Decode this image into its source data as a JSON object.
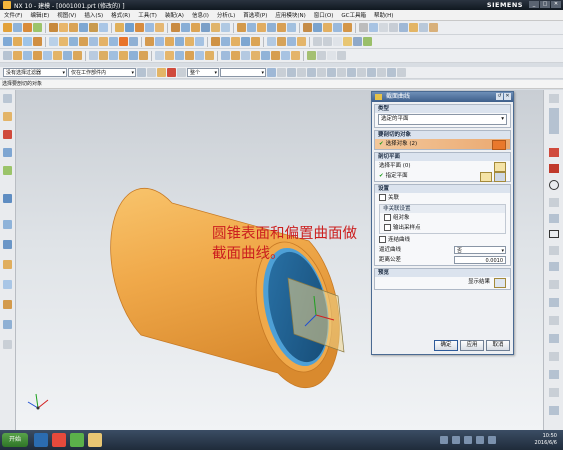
{
  "window": {
    "title": "NX 10 - 建模 - [0001001.prt (修改的) ]",
    "brand": "SIEMENS",
    "controls": [
      "_",
      "□",
      "✕"
    ]
  },
  "menu": [
    "文件(F)",
    "编辑(E)",
    "视图(V)",
    "插入(S)",
    "格式(R)",
    "工具(T)",
    "装配(A)",
    "信息(I)",
    "分析(L)",
    "首选项(P)",
    "应用模块(N)",
    "窗口(O)",
    "GC工具箱",
    "帮助(H)"
  ],
  "toolbar4": {
    "filter": "没有选择过滤器",
    "scope": "仅在工作部件内",
    "snap": "整个"
  },
  "breadcrumb": "选择要剖切的对象",
  "annotation": {
    "line1": "圆锥表面和偏置曲面做",
    "line2": "截面曲线。"
  },
  "dialog": {
    "title": "截面曲线",
    "type_header": "类型",
    "type_value": "选定的平面",
    "objects_header": "要剖切的对象",
    "objects_selected": "选择对象 (2)",
    "plane_header": "剖切平面",
    "plane_select": "选择平面 (0)",
    "plane_specify": "指定平面",
    "settings_header": "设置",
    "associative": "关联",
    "nonassoc_header": "非关联设置",
    "group_objects": "组对象",
    "output_points": "输出采样点",
    "join_curves": "连结曲线",
    "approx_label": "逼近曲线",
    "approx_value": "否",
    "tolerance_label": "距离公差",
    "tolerance_value": "0.0010",
    "preview_header": "预览",
    "show_result": "显示结果",
    "ok": "确定",
    "apply": "应用",
    "cancel": "取消"
  },
  "taskbar": {
    "start": "开始",
    "time": "10:50",
    "date": "2016/6/6"
  },
  "colors": {
    "cylinder": "#f0a94a",
    "end_face": "#1f5f8f",
    "annotation": "#cc1f1f",
    "selection": "#eaa971"
  }
}
